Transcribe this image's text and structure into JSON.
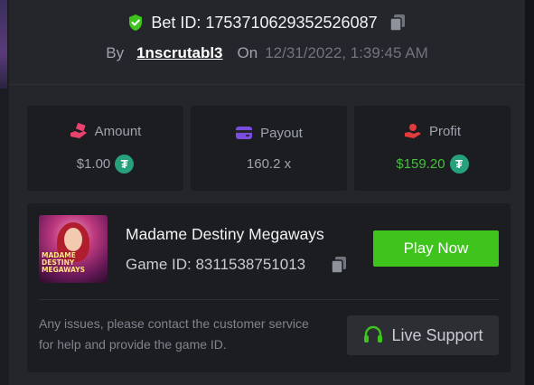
{
  "bet": {
    "label": "Bet ID: 1753710629352526087",
    "by_label": "By",
    "username": "1nscrutabl3",
    "on_label": "On",
    "datetime": "12/31/2022, 1:39:45 AM"
  },
  "stats": {
    "amount": {
      "label": "Amount",
      "value": "$1.00"
    },
    "payout": {
      "label": "Payout",
      "value": "160.2 x"
    },
    "profit": {
      "label": "Profit",
      "value": "$159.20"
    }
  },
  "game": {
    "name": "Madame Destiny Megaways",
    "id_label": "Game ID: 8311538751013",
    "thumbnail_text": "MADAME DESTINY MEGAWAYS",
    "play_label": "Play Now",
    "notice": "Any issues, please contact the customer service for help and provide the game ID.",
    "support_label": "Live Support"
  },
  "icons": {
    "verified": "shield-check-icon",
    "copy": "copy-icon",
    "amount": "hand-money-icon",
    "payout": "wallet-icon",
    "profit": "hand-heart-icon",
    "currency": "tether-coin-icon",
    "support": "headset-icon"
  },
  "colors": {
    "accent_green": "#3ec41c",
    "profit_green": "#45c03a",
    "amount_icon": "#e8436f",
    "payout_icon": "#7b4ce0",
    "profit_icon": "#e23b3b",
    "tether": "#26a17b"
  }
}
